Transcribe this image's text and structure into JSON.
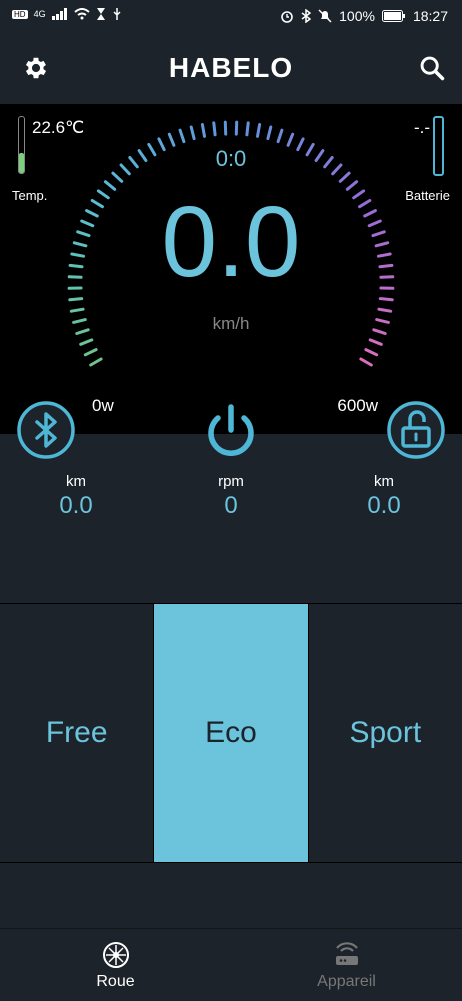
{
  "status_bar": {
    "network": "4G",
    "battery": "100%",
    "time": "18:27"
  },
  "app": {
    "title": "HABELO"
  },
  "dashboard": {
    "temperature": {
      "value": "22.6℃",
      "label": "Temp."
    },
    "battery": {
      "value": "-.-",
      "label": "Batterie"
    },
    "timer": "0:0",
    "speed": "0.0",
    "speed_unit": "km/h",
    "power_min": "0w",
    "power_max": "600w"
  },
  "stats": [
    {
      "label": "km",
      "value": "0.0"
    },
    {
      "label": "rpm",
      "value": "0"
    },
    {
      "label": "km",
      "value": "0.0"
    }
  ],
  "modes": {
    "items": [
      "Free",
      "Eco",
      "Sport"
    ],
    "selected": "Eco"
  },
  "nav": {
    "items": [
      {
        "label": "Roue"
      },
      {
        "label": "Appareil"
      }
    ]
  },
  "colors": {
    "accent": "#6cc3dc",
    "background": "#1c232b",
    "dash_bg": "#000000"
  }
}
